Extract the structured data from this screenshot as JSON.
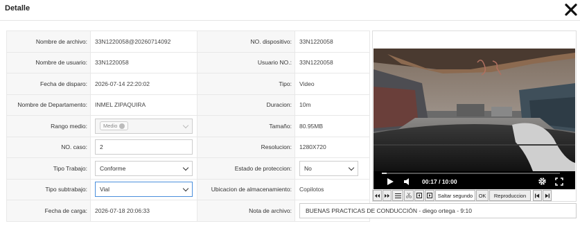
{
  "dialog": {
    "title": "Detalle",
    "close_icon": "close-icon"
  },
  "fields": {
    "nombre_archivo": {
      "label": "Nombre de archivo:",
      "value": "33N1220058@20260714092"
    },
    "no_dispositivo": {
      "label": "NO. dispositivo:",
      "value": "33N1220058"
    },
    "nombre_usuario": {
      "label": "Nombre de usuario:",
      "value": "33N1220058"
    },
    "usuario_no": {
      "label": "Usuario NO.:",
      "value": "33N1220058"
    },
    "fecha_disparo": {
      "label": "Fecha de disparo:",
      "value": "2026-07-14 22:20:02"
    },
    "tipo": {
      "label": "Tipo:",
      "value": "Video"
    },
    "departamento": {
      "label": "Nombre de Departamento:",
      "value": "INMEL ZIPAQUIRA"
    },
    "duracion": {
      "label": "Duracion:",
      "value": "10m"
    },
    "rango_medio": {
      "label": "Rango medio:",
      "chip": "Medio"
    },
    "tamano": {
      "label": "Tamaño:",
      "value": "80.95MB"
    },
    "no_caso": {
      "label": "NO. caso:",
      "value": "2"
    },
    "resolucion": {
      "label": "Resolucion:",
      "value": "1280X720"
    },
    "tipo_trabajo": {
      "label": "Tipo Trabajo:",
      "value": "Conforme"
    },
    "estado_proteccion": {
      "label": "Estado de proteccion:",
      "value": "No"
    },
    "tipo_subtrabajo": {
      "label": "Tipo subtrabajo:",
      "value": "Vial"
    },
    "ubicacion": {
      "label": "Ubicacion de almacenamiento:",
      "value": "Copilotos"
    },
    "fecha_carga": {
      "label": "Fecha de carga:",
      "value": "2026-07-18 20:06:33"
    },
    "nota_archivo": {
      "label": "Nota de archivo:",
      "value": "BUENAS PRACTICAS DE CONDUCCIÓN - diego ortega - 9:10"
    }
  },
  "player": {
    "current_time": "00:17",
    "total_time": "10:00",
    "time_display": "00:17 / 10:00",
    "progress_fraction": 0.028,
    "tools": {
      "skip_label": "Saltar segundo",
      "ok_label": "OK",
      "playback_label": "Reproduccion"
    }
  }
}
